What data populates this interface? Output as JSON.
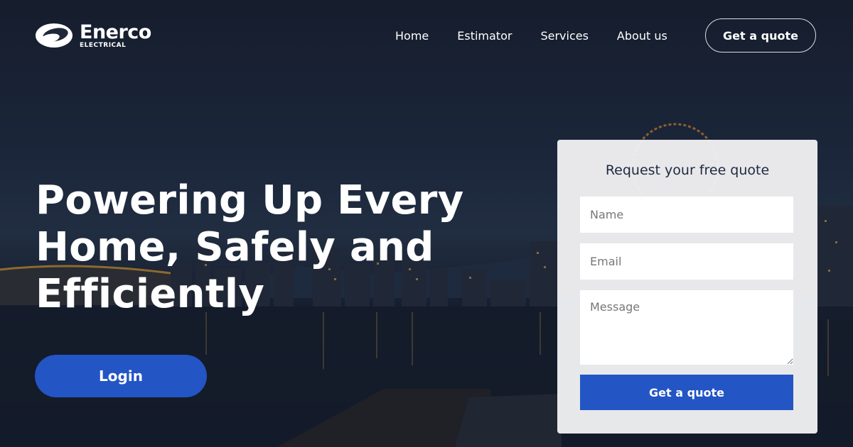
{
  "brand": {
    "name": "Enerco",
    "tagline": "ELECTRICAL"
  },
  "nav": {
    "items": [
      {
        "label": "Home"
      },
      {
        "label": "Estimator"
      },
      {
        "label": "Services"
      },
      {
        "label": "About us"
      }
    ],
    "cta_label": "Get a quote"
  },
  "hero": {
    "title": "Powering Up Every Home, Safely and Efficiently",
    "login_label": "Login"
  },
  "form": {
    "title": "Request your free quote",
    "name_placeholder": "Name",
    "email_placeholder": "Email",
    "message_placeholder": "Message",
    "submit_label": "Get a quote"
  },
  "colors": {
    "accent": "#2355c4",
    "text_dark": "#1d2a3f",
    "card_bg": "#f0f0f2"
  }
}
